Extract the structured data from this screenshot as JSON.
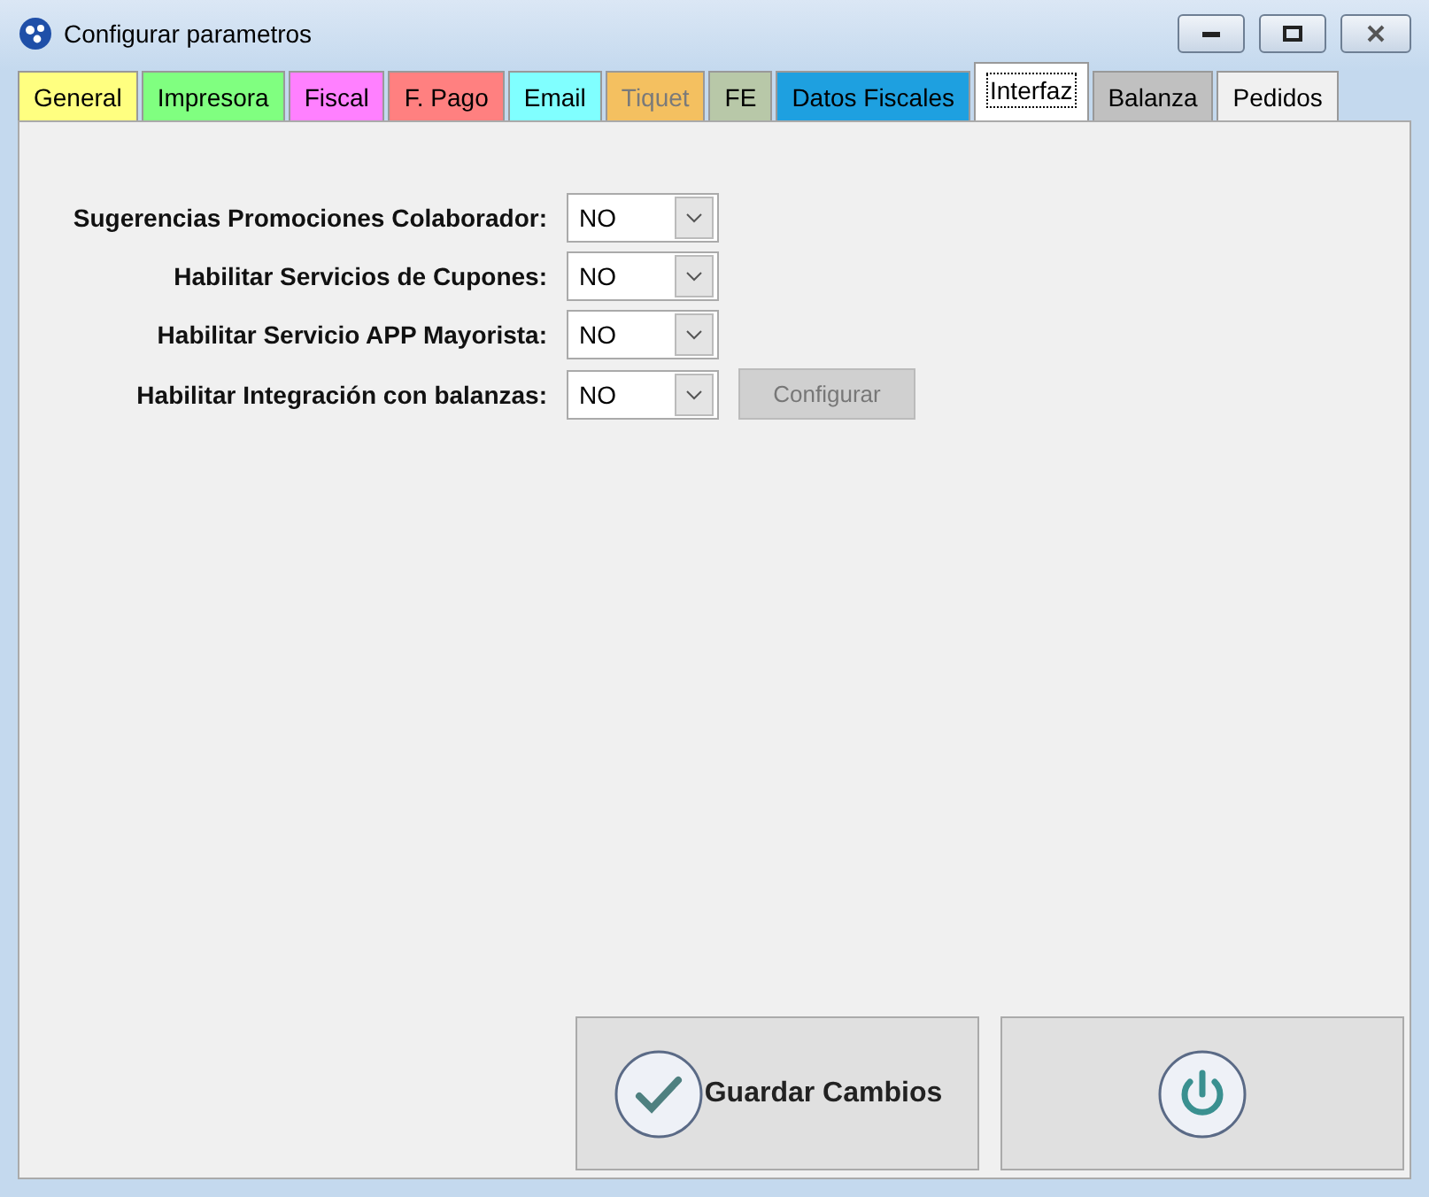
{
  "window": {
    "title": "Configurar parametros"
  },
  "tabs": [
    {
      "label": "General",
      "color": "#ffff80",
      "selected": false,
      "disabled": false
    },
    {
      "label": "Impresora",
      "color": "#80ff80",
      "selected": false,
      "disabled": false
    },
    {
      "label": "Fiscal",
      "color": "#ff80ff",
      "selected": false,
      "disabled": false
    },
    {
      "label": "F. Pago",
      "color": "#ff8080",
      "selected": false,
      "disabled": false
    },
    {
      "label": "Email",
      "color": "#80ffff",
      "selected": false,
      "disabled": false
    },
    {
      "label": "Tiquet",
      "color": "#f4c060",
      "selected": false,
      "disabled": true
    },
    {
      "label": "FE",
      "color": "#b8c8a8",
      "selected": false,
      "disabled": false
    },
    {
      "label": "Datos Fiscales",
      "color": "#1ea0e0",
      "selected": false,
      "disabled": false
    },
    {
      "label": "Interfaz",
      "color": "#ffffff",
      "selected": true,
      "disabled": false
    },
    {
      "label": "Balanza",
      "color": "#c0c0c0",
      "selected": false,
      "disabled": false
    },
    {
      "label": "Pedidos",
      "color": "#f0f0f0",
      "selected": false,
      "disabled": false
    }
  ],
  "settings": [
    {
      "label": "Sugerencias Promociones Colaborador:",
      "value": "NO"
    },
    {
      "label": "Habilitar Servicios de Cupones:",
      "value": "NO"
    },
    {
      "label": "Habilitar Servicio APP Mayorista:",
      "value": "NO"
    },
    {
      "label": "Habilitar Integración con balanzas:",
      "value": "NO",
      "button": {
        "label": "Configurar",
        "disabled": true
      }
    }
  ],
  "actions": [
    {
      "kind": "save",
      "label": "Guardar Cambios"
    },
    {
      "kind": "power"
    }
  ]
}
